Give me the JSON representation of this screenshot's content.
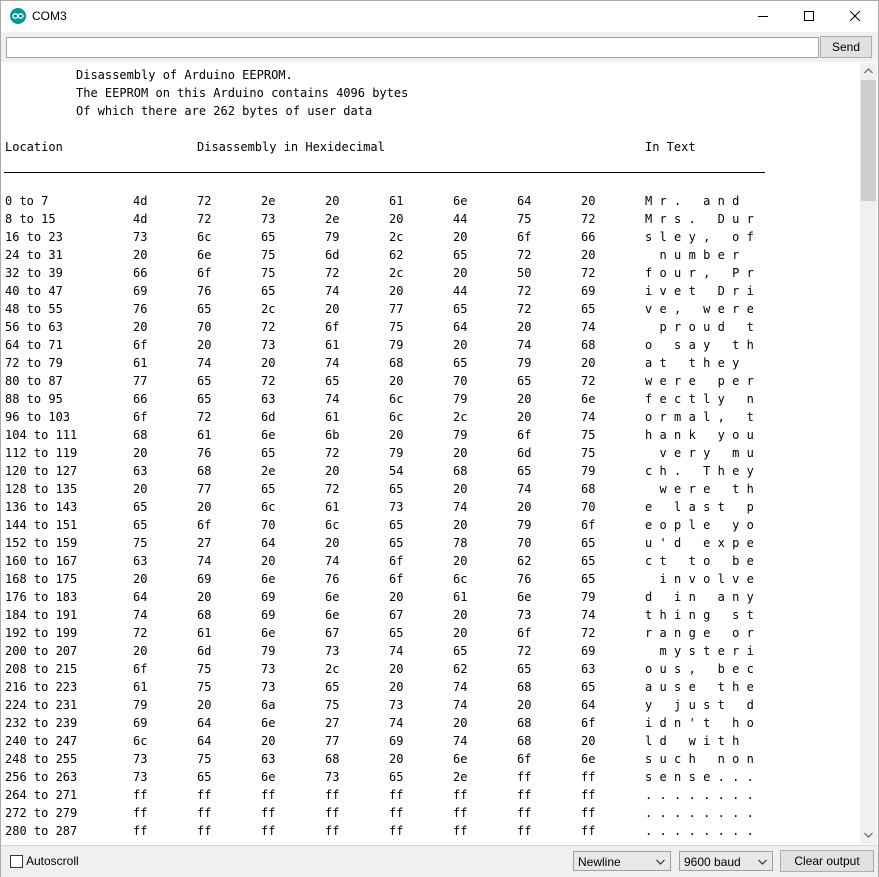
{
  "window": {
    "title": "COM3"
  },
  "toolbar": {
    "input_value": "",
    "send_label": "Send"
  },
  "header": {
    "line1": "Disassembly of Arduino EEPROM.",
    "line2": "The EEPROM on this Arduino contains 4096 bytes",
    "line3": "Of which there are 262 bytes of user data",
    "col_location": "Location",
    "col_hex": "Disassembly in Hexidecimal",
    "col_text": "In Text"
  },
  "rows": [
    {
      "loc": "0 to 7",
      "hex": [
        "4d",
        "72",
        "2e",
        "20",
        "61",
        "6e",
        "64",
        "20"
      ],
      "text": "Mr. and "
    },
    {
      "loc": "8 to 15",
      "hex": [
        "4d",
        "72",
        "73",
        "2e",
        "20",
        "44",
        "75",
        "72"
      ],
      "text": "Mrs. Dur"
    },
    {
      "loc": "16 to 23",
      "hex": [
        "73",
        "6c",
        "65",
        "79",
        "2c",
        "20",
        "6f",
        "66"
      ],
      "text": "sley, of"
    },
    {
      "loc": "24 to 31",
      "hex": [
        "20",
        "6e",
        "75",
        "6d",
        "62",
        "65",
        "72",
        "20"
      ],
      "text": " number "
    },
    {
      "loc": "32 to 39",
      "hex": [
        "66",
        "6f",
        "75",
        "72",
        "2c",
        "20",
        "50",
        "72"
      ],
      "text": "four, Pr"
    },
    {
      "loc": "40 to 47",
      "hex": [
        "69",
        "76",
        "65",
        "74",
        "20",
        "44",
        "72",
        "69"
      ],
      "text": "ivet Dri"
    },
    {
      "loc": "48 to 55",
      "hex": [
        "76",
        "65",
        "2c",
        "20",
        "77",
        "65",
        "72",
        "65"
      ],
      "text": "ve, were"
    },
    {
      "loc": "56 to 63",
      "hex": [
        "20",
        "70",
        "72",
        "6f",
        "75",
        "64",
        "20",
        "74"
      ],
      "text": " proud t"
    },
    {
      "loc": "64 to 71",
      "hex": [
        "6f",
        "20",
        "73",
        "61",
        "79",
        "20",
        "74",
        "68"
      ],
      "text": "o say th"
    },
    {
      "loc": "72 to 79",
      "hex": [
        "61",
        "74",
        "20",
        "74",
        "68",
        "65",
        "79",
        "20"
      ],
      "text": "at they "
    },
    {
      "loc": "80 to 87",
      "hex": [
        "77",
        "65",
        "72",
        "65",
        "20",
        "70",
        "65",
        "72"
      ],
      "text": "were per"
    },
    {
      "loc": "88 to 95",
      "hex": [
        "66",
        "65",
        "63",
        "74",
        "6c",
        "79",
        "20",
        "6e"
      ],
      "text": "fectly n"
    },
    {
      "loc": "96 to 103",
      "hex": [
        "6f",
        "72",
        "6d",
        "61",
        "6c",
        "2c",
        "20",
        "74"
      ],
      "text": "ormal, t"
    },
    {
      "loc": "104 to 111",
      "hex": [
        "68",
        "61",
        "6e",
        "6b",
        "20",
        "79",
        "6f",
        "75"
      ],
      "text": "hank you"
    },
    {
      "loc": "112 to 119",
      "hex": [
        "20",
        "76",
        "65",
        "72",
        "79",
        "20",
        "6d",
        "75"
      ],
      "text": " very mu"
    },
    {
      "loc": "120 to 127",
      "hex": [
        "63",
        "68",
        "2e",
        "20",
        "54",
        "68",
        "65",
        "79"
      ],
      "text": "ch. They"
    },
    {
      "loc": "128 to 135",
      "hex": [
        "20",
        "77",
        "65",
        "72",
        "65",
        "20",
        "74",
        "68"
      ],
      "text": " were th"
    },
    {
      "loc": "136 to 143",
      "hex": [
        "65",
        "20",
        "6c",
        "61",
        "73",
        "74",
        "20",
        "70"
      ],
      "text": "e last p"
    },
    {
      "loc": "144 to 151",
      "hex": [
        "65",
        "6f",
        "70",
        "6c",
        "65",
        "20",
        "79",
        "6f"
      ],
      "text": "eople yo"
    },
    {
      "loc": "152 to 159",
      "hex": [
        "75",
        "27",
        "64",
        "20",
        "65",
        "78",
        "70",
        "65"
      ],
      "text": "u'd expe"
    },
    {
      "loc": "160 to 167",
      "hex": [
        "63",
        "74",
        "20",
        "74",
        "6f",
        "20",
        "62",
        "65"
      ],
      "text": "ct to be"
    },
    {
      "loc": "168 to 175",
      "hex": [
        "20",
        "69",
        "6e",
        "76",
        "6f",
        "6c",
        "76",
        "65"
      ],
      "text": " involve"
    },
    {
      "loc": "176 to 183",
      "hex": [
        "64",
        "20",
        "69",
        "6e",
        "20",
        "61",
        "6e",
        "79"
      ],
      "text": "d in any"
    },
    {
      "loc": "184 to 191",
      "hex": [
        "74",
        "68",
        "69",
        "6e",
        "67",
        "20",
        "73",
        "74"
      ],
      "text": "thing st"
    },
    {
      "loc": "192 to 199",
      "hex": [
        "72",
        "61",
        "6e",
        "67",
        "65",
        "20",
        "6f",
        "72"
      ],
      "text": "range or"
    },
    {
      "loc": "200 to 207",
      "hex": [
        "20",
        "6d",
        "79",
        "73",
        "74",
        "65",
        "72",
        "69"
      ],
      "text": " mysteri"
    },
    {
      "loc": "208 to 215",
      "hex": [
        "6f",
        "75",
        "73",
        "2c",
        "20",
        "62",
        "65",
        "63"
      ],
      "text": "ous, bec"
    },
    {
      "loc": "216 to 223",
      "hex": [
        "61",
        "75",
        "73",
        "65",
        "20",
        "74",
        "68",
        "65"
      ],
      "text": "ause the"
    },
    {
      "loc": "224 to 231",
      "hex": [
        "79",
        "20",
        "6a",
        "75",
        "73",
        "74",
        "20",
        "64"
      ],
      "text": "y just d"
    },
    {
      "loc": "232 to 239",
      "hex": [
        "69",
        "64",
        "6e",
        "27",
        "74",
        "20",
        "68",
        "6f"
      ],
      "text": "idn't ho"
    },
    {
      "loc": "240 to 247",
      "hex": [
        "6c",
        "64",
        "20",
        "77",
        "69",
        "74",
        "68",
        "20"
      ],
      "text": "ld with "
    },
    {
      "loc": "248 to 255",
      "hex": [
        "73",
        "75",
        "63",
        "68",
        "20",
        "6e",
        "6f",
        "6e"
      ],
      "text": "such non"
    },
    {
      "loc": "256 to 263",
      "hex": [
        "73",
        "65",
        "6e",
        "73",
        "65",
        "2e",
        "ff",
        "ff"
      ],
      "text": "sense..."
    },
    {
      "loc": "264 to 271",
      "hex": [
        "ff",
        "ff",
        "ff",
        "ff",
        "ff",
        "ff",
        "ff",
        "ff"
      ],
      "text": "........"
    },
    {
      "loc": "272 to 279",
      "hex": [
        "ff",
        "ff",
        "ff",
        "ff",
        "ff",
        "ff",
        "ff",
        "ff"
      ],
      "text": "........"
    },
    {
      "loc": "280 to 287",
      "hex": [
        "ff",
        "ff",
        "ff",
        "ff",
        "ff",
        "ff",
        "ff",
        "ff"
      ],
      "text": "........"
    }
  ],
  "statusbar": {
    "autoscroll_label": "Autoscroll",
    "autoscroll_checked": false,
    "line_ending": "Newline",
    "baud": "9600 baud",
    "clear_label": "Clear output"
  },
  "colors": {
    "app_icon": "#00979c",
    "chrome": "#f0f0f0"
  },
  "icons": [
    "arduino-logo-icon",
    "minimize-icon",
    "maximize-icon",
    "close-icon",
    "chevron-down-icon",
    "scroll-up-icon",
    "scroll-down-icon"
  ]
}
